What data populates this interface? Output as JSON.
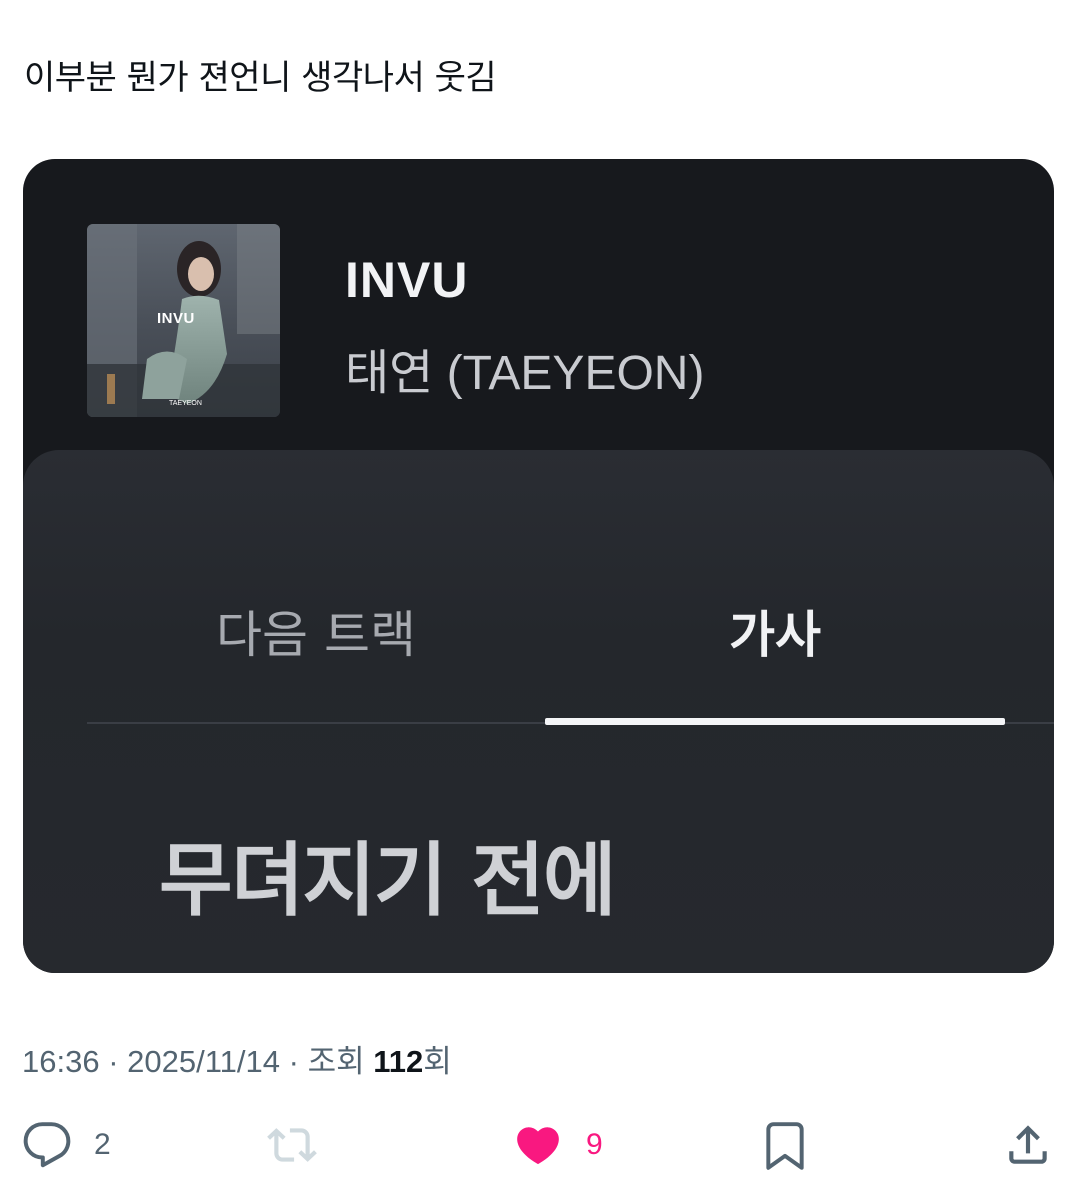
{
  "tweet": {
    "text": "이부분 뭔가 젼언니 생각나서 웃김"
  },
  "player": {
    "album_art_label": "INVU",
    "album_art_artist": "TAEYEON",
    "title": "INVU",
    "artist": "태연 (TAEYEON)",
    "tabs": [
      {
        "label": "다음 트랙",
        "active": false
      },
      {
        "label": "가사",
        "active": true
      }
    ],
    "lyric_line": "무뎌지기 전에",
    "colors": {
      "background": "#17191d",
      "panel": "#2a2d33",
      "indicator": "#f4f5f7"
    }
  },
  "meta": {
    "time": "16:36",
    "separator1": " · ",
    "date": "2025/11/14",
    "separator2": " · ",
    "views_label": "조회 ",
    "views_count": "112",
    "views_suffix": "회"
  },
  "actions": {
    "reply": {
      "icon": "reply-icon",
      "count": "2"
    },
    "retweet": {
      "icon": "retweet-icon",
      "count": ""
    },
    "like": {
      "icon": "heart-icon",
      "count": "9",
      "liked": true,
      "color": "#f91880"
    },
    "bookmark": {
      "icon": "bookmark-icon"
    },
    "share": {
      "icon": "share-icon"
    }
  }
}
